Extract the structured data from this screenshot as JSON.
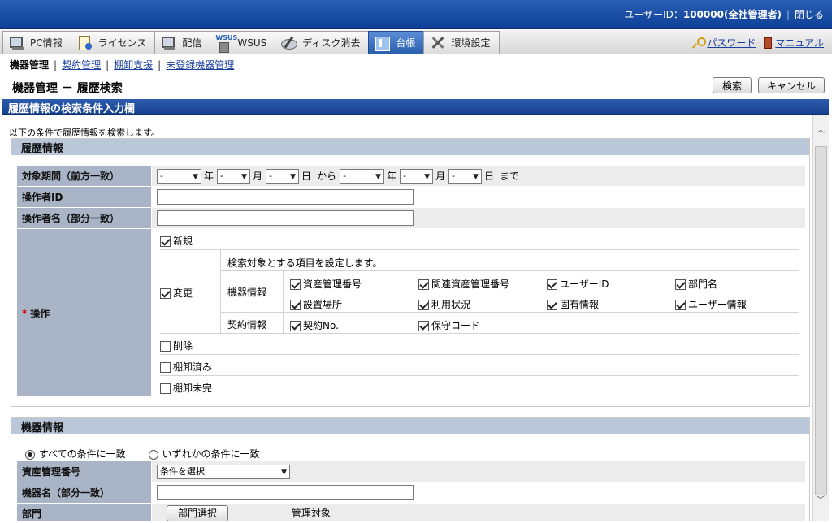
{
  "header": {
    "user_label": "ユーザーID：",
    "user_value": "100000(全社管理者)",
    "logout": "閉じる"
  },
  "tabs": [
    {
      "label": "PC情報",
      "icon": "pc-icon"
    },
    {
      "label": "ライセンス",
      "icon": "license-icon"
    },
    {
      "label": "配信",
      "icon": "distribution-icon"
    },
    {
      "label": "WSUS",
      "icon": "wsus-icon"
    },
    {
      "label": "ディスク消去",
      "icon": "disk-erase-icon"
    },
    {
      "label": "台帳",
      "icon": "ledger-icon"
    },
    {
      "label": "環境設定",
      "icon": "settings-icon"
    }
  ],
  "wsus_icon_text": "WSUS",
  "right_links": {
    "password": "パスワード",
    "manual": "マニュアル"
  },
  "subnav": {
    "current": "機器管理",
    "links": [
      "契約管理",
      "棚卸支援",
      "未登録機器管理"
    ]
  },
  "page_title": "機器管理 － 履歴検索",
  "buttons": {
    "search": "検索",
    "cancel": "キャンセル"
  },
  "section_title": "履歴情報の検索条件入力欄",
  "intro": "以下の条件で履歴情報を検索します。",
  "history": {
    "heading": "履歴情報",
    "period_label": "対象期間（前方一致）",
    "dash": "-",
    "year": "年",
    "month": "月",
    "day": "日",
    "from": "から",
    "until": "まで",
    "operator_id_label": "操作者ID",
    "operator_name_label": "操作者名（部分一致）",
    "operation_label": "操作",
    "required_mark": "*",
    "ops": {
      "new": "新規",
      "change": "変更",
      "change_desc": "検索対象とする項目を設定します。",
      "device_info": "機器情報",
      "contract_info": "契約情報",
      "device_items": [
        "資産管理番号",
        "関連資産管理番号",
        "ユーザーID",
        "部門名",
        "設置場所",
        "利用状況",
        "固有情報",
        "ユーザー情報"
      ],
      "contract_items": [
        "契約No.",
        "保守コード"
      ],
      "delete": "削除",
      "inventory_done": "棚卸済み",
      "inventory_pending": "棚卸未完"
    }
  },
  "device": {
    "heading": "機器情報",
    "match_all": "すべての条件に一致",
    "match_any": "いずれかの条件に一致",
    "asset_label": "資産管理番号",
    "asset_select": "条件を選択",
    "name_label": "機器名（部分一致）",
    "dept_label": "部門",
    "dept_button": "部門選択",
    "dept_target": "管理対象"
  }
}
